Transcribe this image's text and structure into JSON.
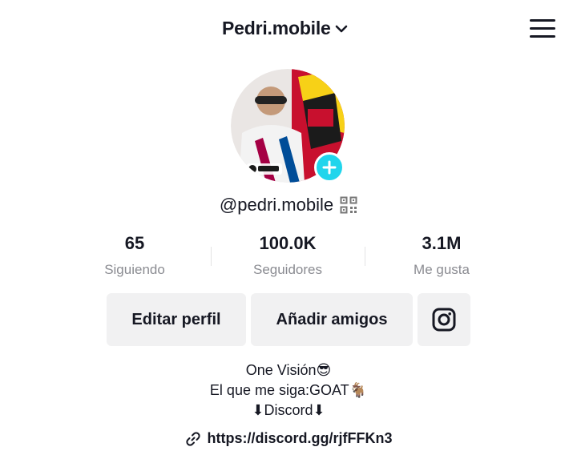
{
  "header": {
    "account_name": "Pedri.mobile"
  },
  "profile": {
    "handle": "@pedri.mobile"
  },
  "stats": [
    {
      "value": "65",
      "label": "Siguiendo"
    },
    {
      "value": "100.0K",
      "label": "Seguidores"
    },
    {
      "value": "3.1M",
      "label": "Me gusta"
    }
  ],
  "actions": {
    "edit_label": "Editar perfil",
    "friends_label": "Añadir amigos",
    "instagram_icon": "instagram-icon"
  },
  "bio": {
    "line1": "One Visión😎",
    "line2": "El que me siga:GOAT🐐",
    "line3": "⬇Discord⬇"
  },
  "link": {
    "url": "https://discord.gg/rjfFFKn3"
  },
  "colors": {
    "add_badge": "#20d5ec",
    "button_bg": "#f1f1f2",
    "muted_text": "#8a8b91"
  }
}
